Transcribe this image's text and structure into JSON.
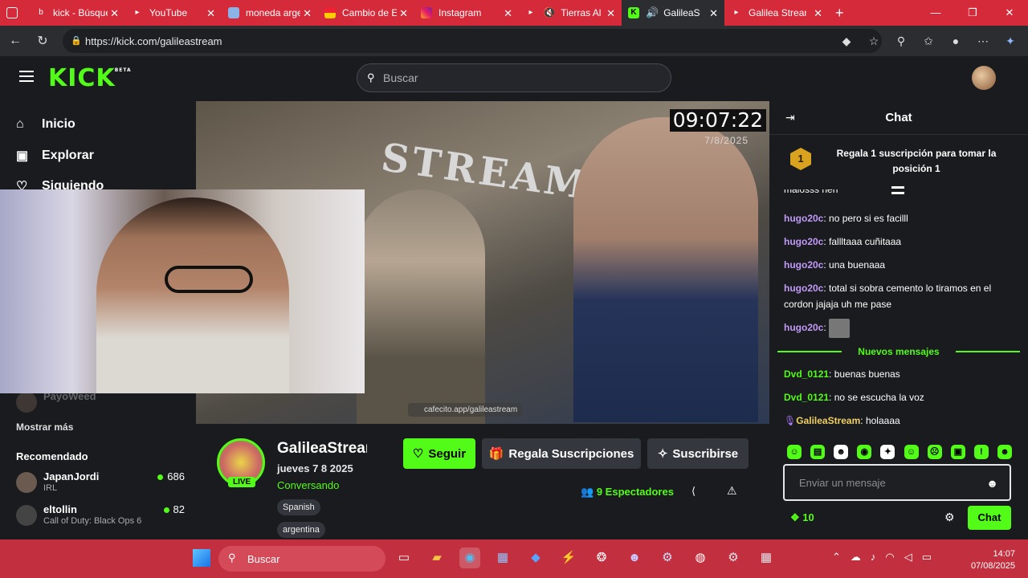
{
  "browser": {
    "tabs": [
      {
        "title": "kick - Búsqueda",
        "icon": "bing-icon"
      },
      {
        "title": "YouTube",
        "icon": "youtube-icon"
      },
      {
        "title": "moneda argentina",
        "icon": "flag-icon"
      },
      {
        "title": "Cambio de Euro",
        "icon": "flag-icon"
      },
      {
        "title": "Instagram",
        "icon": "instagram-icon"
      },
      {
        "title": "Tierras Al",
        "icon": "youtube-icon"
      },
      {
        "title": "GalileaStream",
        "icon": "kick-icon"
      },
      {
        "title": "Galilea Stream",
        "icon": "youtube-icon"
      }
    ],
    "url": "https://kick.com/galileastream"
  },
  "header": {
    "logo": "KICK",
    "logo_badge": "BETA",
    "search_placeholder": "Buscar"
  },
  "sidebar": {
    "nav": [
      {
        "label": "Inicio",
        "icon": "home-icon"
      },
      {
        "label": "Explorar",
        "icon": "compass-icon"
      },
      {
        "label": "Siguiendo",
        "icon": "heart-icon"
      }
    ],
    "partial_channel": "PayoWeed",
    "show_more": "Mostrar más",
    "recommended_title": "Recomendado",
    "recommended": [
      {
        "name": "JapanJordi",
        "category": "IRL",
        "viewers": "686"
      },
      {
        "name": "eltollin",
        "category": "Call of Duty: Black Ops 6",
        "viewers": "82"
      }
    ]
  },
  "player": {
    "clock": "09:07:22",
    "clock_date": "7/8/2025",
    "overlay_sign": "STREAM",
    "cafecito": "cafecito.app/galileastream"
  },
  "stream": {
    "channel_name": "GalileaStream",
    "title": "jueves 7 8 2025",
    "category": "Conversando",
    "live_label": "LIVE",
    "tags": [
      "Spanish",
      "argentina"
    ],
    "follow_label": "Seguir",
    "gift_label": "Regala Suscripciones",
    "subscribe_label": "Suscribirse",
    "viewers_count": "9",
    "viewers_label": "Espectadores"
  },
  "chat": {
    "title": "Chat",
    "pinned": "Regala 1 suscripción para tomar la posición 1",
    "pinned_rank": "1",
    "messages": [
      {
        "user": "",
        "text": "malosss nen"
      },
      {
        "user": "hugo20c",
        "text": "no pero si es facilll"
      },
      {
        "user": "hugo20c",
        "text": "fallltaaa cuñitaaa"
      },
      {
        "user": "hugo20c",
        "text": "una buenaaa"
      },
      {
        "user": "hugo20c",
        "text": "total si sobra cemento lo tiramos en el cordon jajaja uh me pase"
      },
      {
        "user": "hugo20c",
        "text": ""
      }
    ],
    "new_messages_label": "Nuevos mensajes",
    "new_messages": [
      {
        "user": "Dvd_0121",
        "text": "buenas buenas"
      },
      {
        "user": "Dvd_0121",
        "text": "no se escucha la voz"
      },
      {
        "user": "GalileaStream",
        "text": "holaaaa"
      }
    ],
    "input_placeholder": "Enviar un mensaje",
    "points": "10",
    "send_label": "Chat"
  },
  "taskbar": {
    "search_label": "Buscar",
    "time": "14:07",
    "date": "07/08/2025"
  }
}
